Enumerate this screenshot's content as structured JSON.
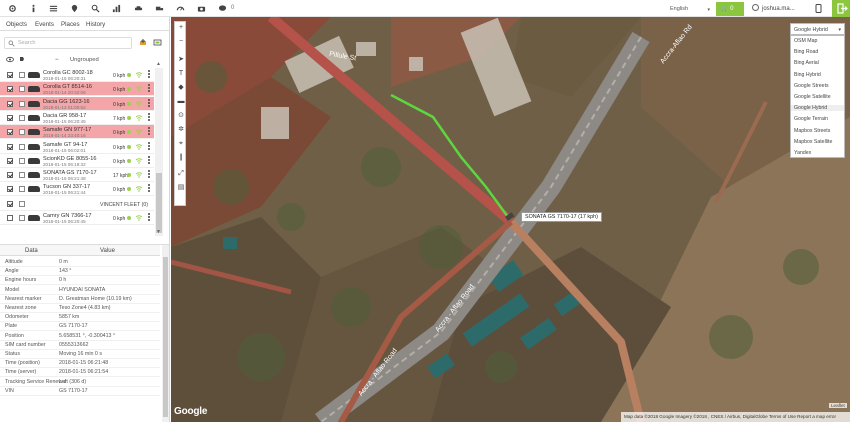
{
  "topbar": {
    "message_count": "0",
    "language": "English",
    "cart_count": "0",
    "username": "joshua.ma..."
  },
  "sidebar": {
    "tabs": [
      "Objects",
      "Events",
      "Places",
      "History"
    ],
    "search_placeholder": "Search",
    "group_name": "Ungrouped",
    "group_toggle": "−",
    "objects": [
      {
        "name": "Corolla GC 8002-18",
        "time": "2018-01-15 06:20:31",
        "speed": "0 kph",
        "alert": false,
        "eye": true
      },
      {
        "name": "Corolla GT 8514-16",
        "time": "2018-01-14 20:32:06",
        "speed": "0 kph",
        "alert": true,
        "eye": true
      },
      {
        "name": "Dacia GG 1623-16",
        "time": "2018-01-12 01:00:52",
        "speed": "0 kph",
        "alert": true,
        "eye": true
      },
      {
        "name": "Dacia GR 958-17",
        "time": "2018-01-15 06:20:45",
        "speed": "7 kph",
        "alert": false,
        "eye": true
      },
      {
        "name": "Samafe GN 977-17",
        "time": "2018-01-14 23:40:16",
        "speed": "0 kph",
        "alert": true,
        "eye": true
      },
      {
        "name": "Samafe GT 94-17",
        "time": "2018-01-15 06:02:01",
        "speed": "0 kph",
        "alert": false,
        "eye": true
      },
      {
        "name": "ScionKD GE 8055-16",
        "time": "2018-01-15 06:19:32",
        "speed": "0 kph",
        "alert": false,
        "eye": true
      },
      {
        "name": "SONATA GS 7170-17",
        "time": "2018-01-15 06:21:48",
        "speed": "17 kph",
        "alert": false,
        "eye": true
      },
      {
        "name": "Tucson GN 337-17",
        "time": "2018-01-15 06:21:44",
        "speed": "0 kph",
        "alert": false,
        "eye": true
      },
      {
        "name": "VINCENT FLEET",
        "time": "",
        "speed": "",
        "alert": false,
        "eye": true,
        "center": "VINCENT FLEET (0)"
      },
      {
        "name": "Camry GN 7366-17",
        "time": "2018-01-15 06:20:45",
        "speed": "0 kph",
        "alert": false,
        "eye": false
      }
    ]
  },
  "details": {
    "col_data": "Data",
    "col_value": "Value",
    "rows": [
      {
        "k": "Altitude",
        "v": "0 m"
      },
      {
        "k": "Angle",
        "v": "143 °"
      },
      {
        "k": "Engine hours",
        "v": "0 h"
      },
      {
        "k": "Model",
        "v": "HYUNDAI SONATA"
      },
      {
        "k": "Nearest marker",
        "v": "D. Greatman Home (10.19 km)"
      },
      {
        "k": "Nearest zone",
        "v": "Teso Zone4 (4.83 km)"
      },
      {
        "k": "Odometer",
        "v": "5857 km"
      },
      {
        "k": "Plate",
        "v": "GS 7170-17"
      },
      {
        "k": "Position",
        "v": "5.658531 °, -0.300413 °"
      },
      {
        "k": "SIM card number",
        "v": "0555313662"
      },
      {
        "k": "Status",
        "v": "Moving 16 min 0 s"
      },
      {
        "k": "Time (position)",
        "v": "2018-01-15 06:21:48"
      },
      {
        "k": "Time (server)",
        "v": "2018-01-15 06:21:54"
      },
      {
        "k": "Tracking Service Renewal",
        "v": "Left (306 d)"
      },
      {
        "k": "VIN",
        "v": "GS 7170-17"
      }
    ]
  },
  "map": {
    "selected_layer": "Google Hybrid",
    "layers": [
      "OSM Map",
      "Bing Road",
      "Bing Aerial",
      "Bing Hybrid",
      "Google Streets",
      "Google Satellite",
      "Google Hybrid",
      "Google Terrain",
      "Mapbox Streets",
      "Mapbox Satellite",
      "Yandex"
    ],
    "vehicle_label": "SONATA GS 7170-17 (17 kph)",
    "google_logo": "Google",
    "attribution": "Map data ©2018 Google Imagery ©2018 , CNES / Airbus, DigitalGlobe    Terms of Use    Report a map error",
    "leaflet": "Leaflet",
    "road_labels": [
      "Accra-Aflao Rd",
      "Accra - Aflao Road",
      "Accra - Aflao Road",
      "Pillule St"
    ]
  },
  "colors": {
    "accent": "#8cc63f",
    "alert_row": "#f3a5a8",
    "route": "#5ed640"
  }
}
